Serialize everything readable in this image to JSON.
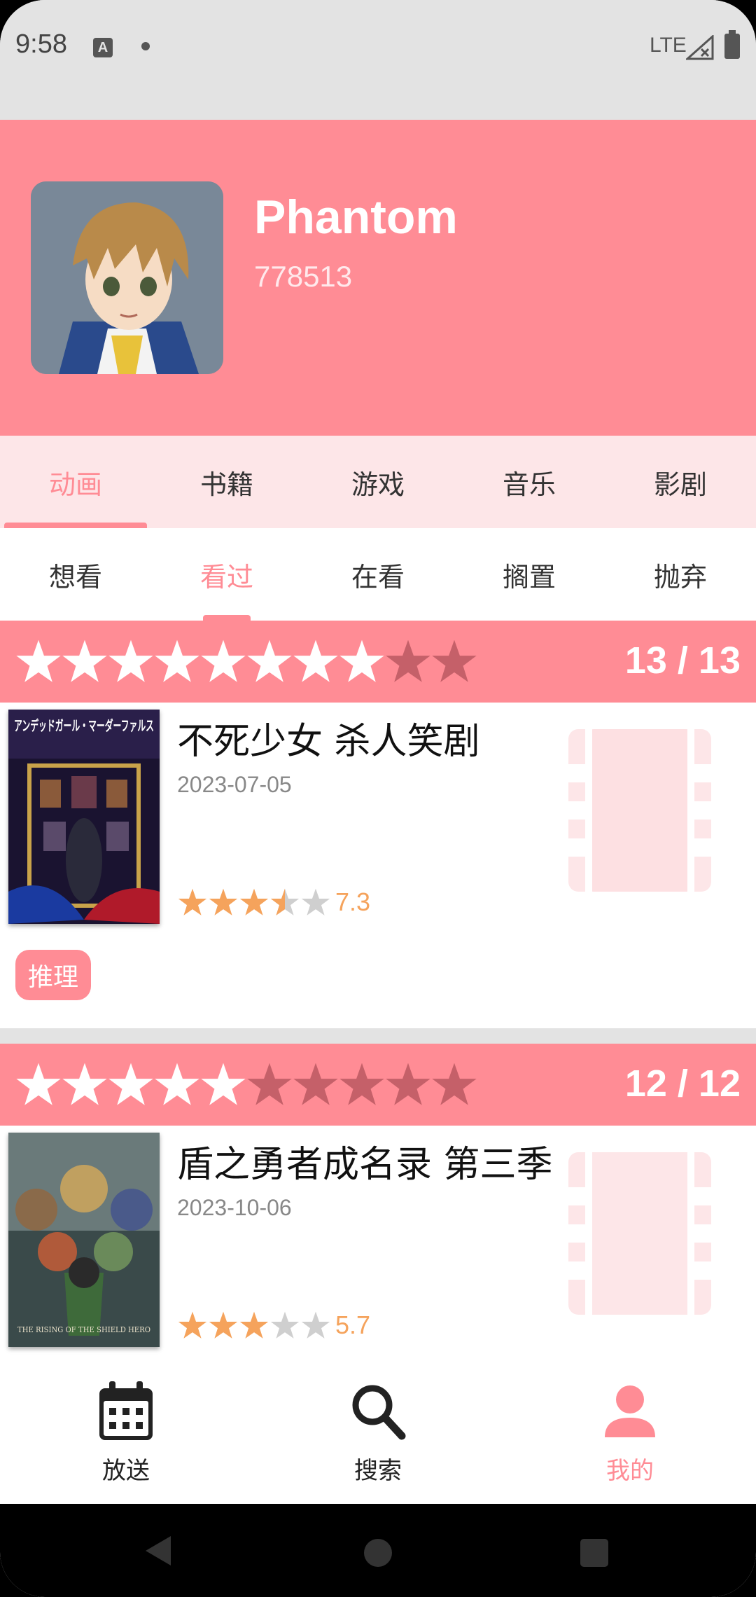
{
  "status_bar": {
    "time": "9:58",
    "network": "LTE",
    "input_indicator": "A"
  },
  "profile": {
    "name": "Phantom",
    "id": "778513",
    "avatar_icon": "anime-boy-avatar"
  },
  "category_tabs": [
    "动画",
    "书籍",
    "游戏",
    "音乐",
    "影剧"
  ],
  "category_active": 0,
  "status_tabs": [
    "想看",
    "看过",
    "在看",
    "搁置",
    "抛弃"
  ],
  "status_active": 1,
  "colors": {
    "accent": "#ff8c95",
    "accent_light": "#fde6e8",
    "star_rating": "#f5a35c"
  },
  "items": [
    {
      "user_rating_stars": 8,
      "user_rating_max": 10,
      "progress": "13 / 13",
      "title": "不死少女 杀人笑剧",
      "date": "2023-07-05",
      "score_stars": 3.5,
      "score": "7.3",
      "tag": "推理",
      "cover_text": "アンデッドガール・マーダーファルス"
    },
    {
      "user_rating_stars": 5,
      "user_rating_max": 10,
      "progress": "12 / 12",
      "title": "盾之勇者成名录 第三季",
      "date": "2023-10-06",
      "score_stars": 3,
      "score": "5.7",
      "cover_text": "THE RISING OF THE SHIELD HERO"
    }
  ],
  "bottom_nav": [
    {
      "label": "放送",
      "icon": "calendar-icon"
    },
    {
      "label": "搜索",
      "icon": "search-icon"
    },
    {
      "label": "我的",
      "icon": "person-icon"
    }
  ],
  "bottom_nav_active": 2
}
